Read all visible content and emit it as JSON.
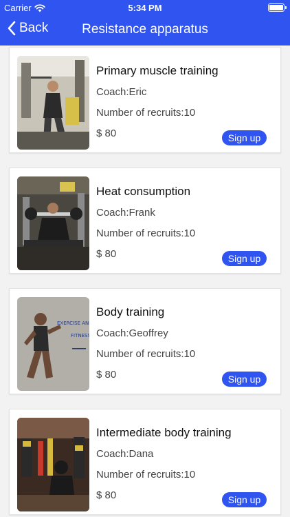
{
  "status_bar": {
    "carrier": "Carrier",
    "time": "5:34 PM",
    "icons": [
      "wifi-icon",
      "battery-icon"
    ]
  },
  "nav": {
    "back_label": "Back",
    "back_icon": "chevron-left-icon",
    "title": "Resistance apparatus"
  },
  "colors": {
    "accent": "#2f54f0",
    "background": "#f2f2f2",
    "card": "#ffffff"
  },
  "courses": [
    {
      "title": "Primary muscle training",
      "coach": "Coach:Eric",
      "recruits": "Number of recruits:10",
      "price": "$ 80",
      "action": "Sign up"
    },
    {
      "title": "Heat consumption",
      "coach": "Coach:Frank",
      "recruits": "Number of recruits:10",
      "price": "$ 80",
      "action": "Sign up"
    },
    {
      "title": "Body training",
      "coach": "Coach:Geoffrey",
      "recruits": "Number of recruits:10",
      "price": "$ 80",
      "action": "Sign up"
    },
    {
      "title": "Intermediate body training",
      "coach": "Coach:Dana",
      "recruits": "Number of recruits:10",
      "price": "$ 80",
      "action": "Sign up"
    }
  ],
  "poster_text": [
    "EXERCISE AND",
    "FITNESS"
  ]
}
